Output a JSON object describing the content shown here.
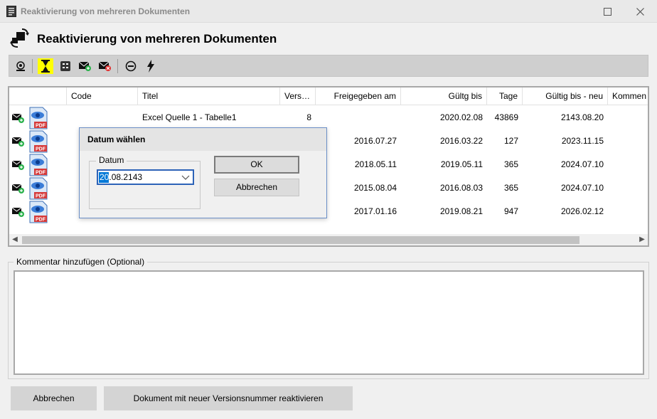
{
  "window": {
    "title": "Reaktivierung von mehreren Dokumenten"
  },
  "header": {
    "title": "Reaktivierung von mehreren Dokumenten",
    "icon": "rotate-squares-icon"
  },
  "toolbar": {
    "buttons": [
      {
        "icon": "view-document-icon"
      },
      {
        "icon": "hourglass-icon",
        "active": true
      },
      {
        "icon": "list-icon"
      },
      {
        "icon": "mail-add-icon"
      },
      {
        "icon": "mail-remove-icon"
      },
      {
        "icon": "minus-circle-icon"
      },
      {
        "icon": "lightning-icon"
      }
    ]
  },
  "grid": {
    "columns": [
      "",
      "Code",
      "Titel",
      "Vers…",
      "Freigegeben am",
      "Gültg bis",
      "Tage",
      "Gültig bis - neu",
      "Kommen"
    ],
    "rows": [
      {
        "code": "",
        "titel": "Excel Quelle 1 - Tabelle1",
        "version": "8",
        "freigegeben": "",
        "gueltig_bis": "2020.02.08",
        "tage": "43869",
        "gueltig_neu": "2143.08.20"
      },
      {
        "code": "",
        "titel": "",
        "version": "",
        "freigegeben": "2016.07.27",
        "gueltig_bis": "2016.03.22",
        "tage": "127",
        "gueltig_neu": "2023.11.15"
      },
      {
        "code": "",
        "titel": "",
        "version": "",
        "freigegeben": "2018.05.11",
        "gueltig_bis": "2019.05.11",
        "tage": "365",
        "gueltig_neu": "2024.07.10"
      },
      {
        "code": "",
        "titel": "",
        "version": "",
        "freigegeben": "2015.08.04",
        "gueltig_bis": "2016.08.03",
        "tage": "365",
        "gueltig_neu": "2024.07.10"
      },
      {
        "code": "",
        "titel": "",
        "version": "",
        "freigegeben": "2017.01.16",
        "gueltig_bis": "2019.08.21",
        "tage": "947",
        "gueltig_neu": "2026.02.12"
      }
    ],
    "row_icons": {
      "mail": "mail-add-icon",
      "pdf": "pdf-document-icon"
    },
    "pdf_label": "PDF"
  },
  "dialog": {
    "title": "Datum wählen",
    "group_label": "Datum",
    "date_selected": "20",
    "date_rest": ".08.2143",
    "ok_label": "OK",
    "cancel_label": "Abbrechen"
  },
  "comment": {
    "label": "Kommentar hinzufügen (Optional)",
    "value": ""
  },
  "footer": {
    "cancel_label": "Abbrechen",
    "reactivate_label": "Dokument mit neuer Versionsnummer reaktivieren"
  },
  "colors": {
    "accent": "#2d63b8",
    "selection": "#0078d7",
    "toolbar_active": "#ffff00"
  }
}
